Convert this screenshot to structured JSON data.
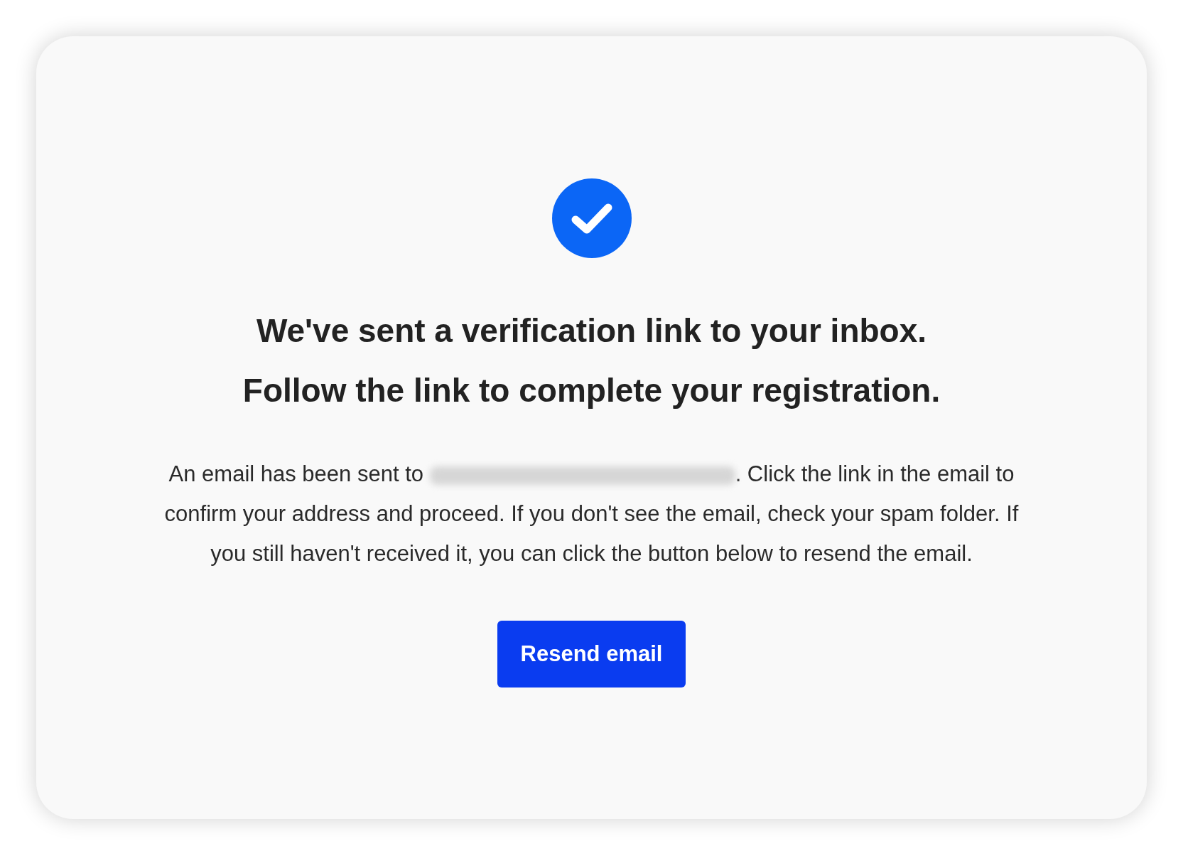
{
  "heading": [
    "We've sent a verification link to your inbox.",
    "Follow the link to complete your registration."
  ],
  "message": {
    "before": "An email has been sent to",
    "after": ". Click the link in the email to confirm your address and proceed. If you don't see the email, check your spam folder. If you still haven't received it, you can click the button below to resend the email."
  },
  "button": {
    "label": "Resend email"
  }
}
